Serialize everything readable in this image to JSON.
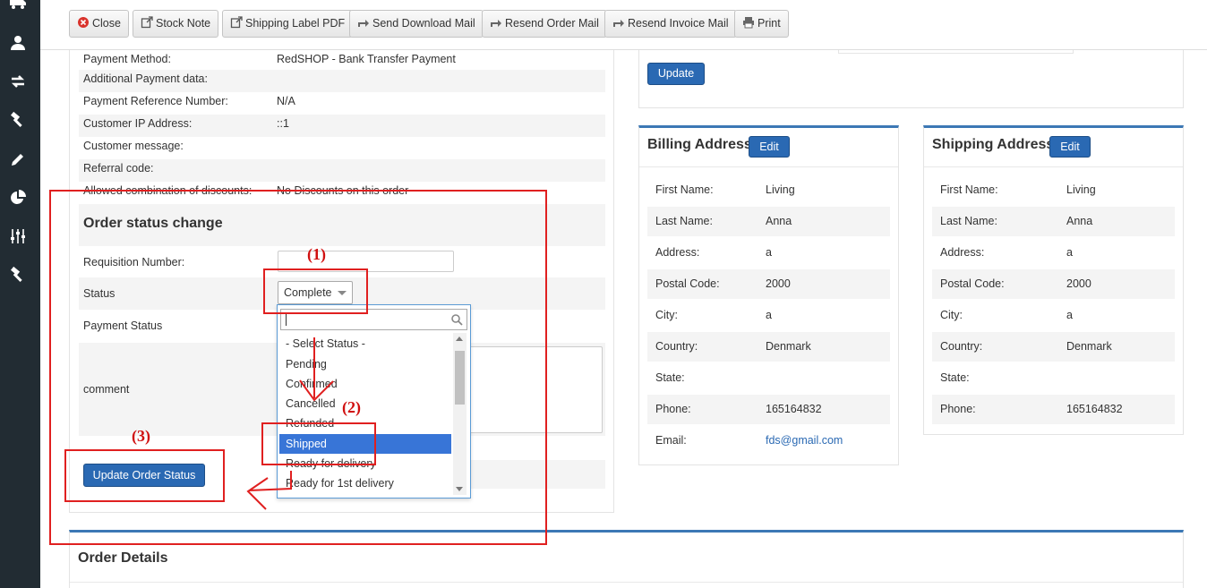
{
  "toolbar": {
    "close": "Close",
    "stock_note": "Stock Note",
    "shipping_label": "Shipping Label PDF",
    "send_download": "Send Download Mail",
    "resend_order": "Resend Order Mail",
    "resend_invoice": "Resend Invoice Mail",
    "print": "Print"
  },
  "sidebar": {
    "icons": [
      "truck-icon",
      "user-icon",
      "exchange-icon",
      "hammer-icon",
      "pencil-icon",
      "pie-chart-icon",
      "sliders-icon",
      "hammer-icon"
    ]
  },
  "payment_info": [
    {
      "label": "Payment Method:",
      "value": "RedSHOP - Bank Transfer Payment"
    },
    {
      "label": "Additional Payment data:",
      "value": ""
    },
    {
      "label": "Payment Reference Number:",
      "value": "N/A"
    },
    {
      "label": "Customer IP Address:",
      "value": "::1"
    },
    {
      "label": "Customer message:",
      "value": ""
    },
    {
      "label": "Referral code:",
      "value": ""
    },
    {
      "label": "Allowed combination of discounts:",
      "value": "No Discounts on this order"
    }
  ],
  "status_change": {
    "title": "Order status change",
    "requisition_label": "Requisition Number:",
    "requisition_value": "",
    "status_label": "Status",
    "status_value": "Complete",
    "payment_status_label": "Payment Status",
    "comment_label": "comment",
    "update_button": "Update Order Status"
  },
  "status_dropdown": {
    "search_value": "",
    "options": [
      "- Select Status -",
      "Pending",
      "Confirmed",
      "Cancelled",
      "Refunded",
      "Shipped",
      "Ready for delivery",
      "Ready for 1st delivery"
    ],
    "highlighted": "Shipped"
  },
  "annotations": {
    "step1": "(1)",
    "step2": "(2)",
    "step3": "(3)",
    "color": "#e02020"
  },
  "top_panel": {
    "update_button": "Update"
  },
  "billing": {
    "title": "Billing Address",
    "edit": "Edit",
    "rows": [
      {
        "label": "First Name:",
        "value": "Living"
      },
      {
        "label": "Last Name:",
        "value": "Anna"
      },
      {
        "label": "Address:",
        "value": "a"
      },
      {
        "label": "Postal Code:",
        "value": "2000"
      },
      {
        "label": "City:",
        "value": "a"
      },
      {
        "label": "Country:",
        "value": "Denmark"
      },
      {
        "label": "State:",
        "value": ""
      },
      {
        "label": "Phone:",
        "value": "165164832"
      },
      {
        "label": "Email:",
        "value": "fds@gmail.com"
      }
    ]
  },
  "shipping": {
    "title": "Shipping Address",
    "edit": "Edit",
    "rows": [
      {
        "label": "First Name:",
        "value": "Living"
      },
      {
        "label": "Last Name:",
        "value": "Anna"
      },
      {
        "label": "Address:",
        "value": "a"
      },
      {
        "label": "Postal Code:",
        "value": "2000"
      },
      {
        "label": "City:",
        "value": "a"
      },
      {
        "label": "Country:",
        "value": "Denmark"
      },
      {
        "label": "State:",
        "value": ""
      },
      {
        "label": "Phone:",
        "value": "165164832"
      }
    ]
  },
  "order_details": {
    "title": "Order Details"
  },
  "colors": {
    "sidebar_bg": "#222c33",
    "primary_button": "#2a69b3",
    "panel_accent": "#3c78b5",
    "selected_option": "#3875d7"
  }
}
